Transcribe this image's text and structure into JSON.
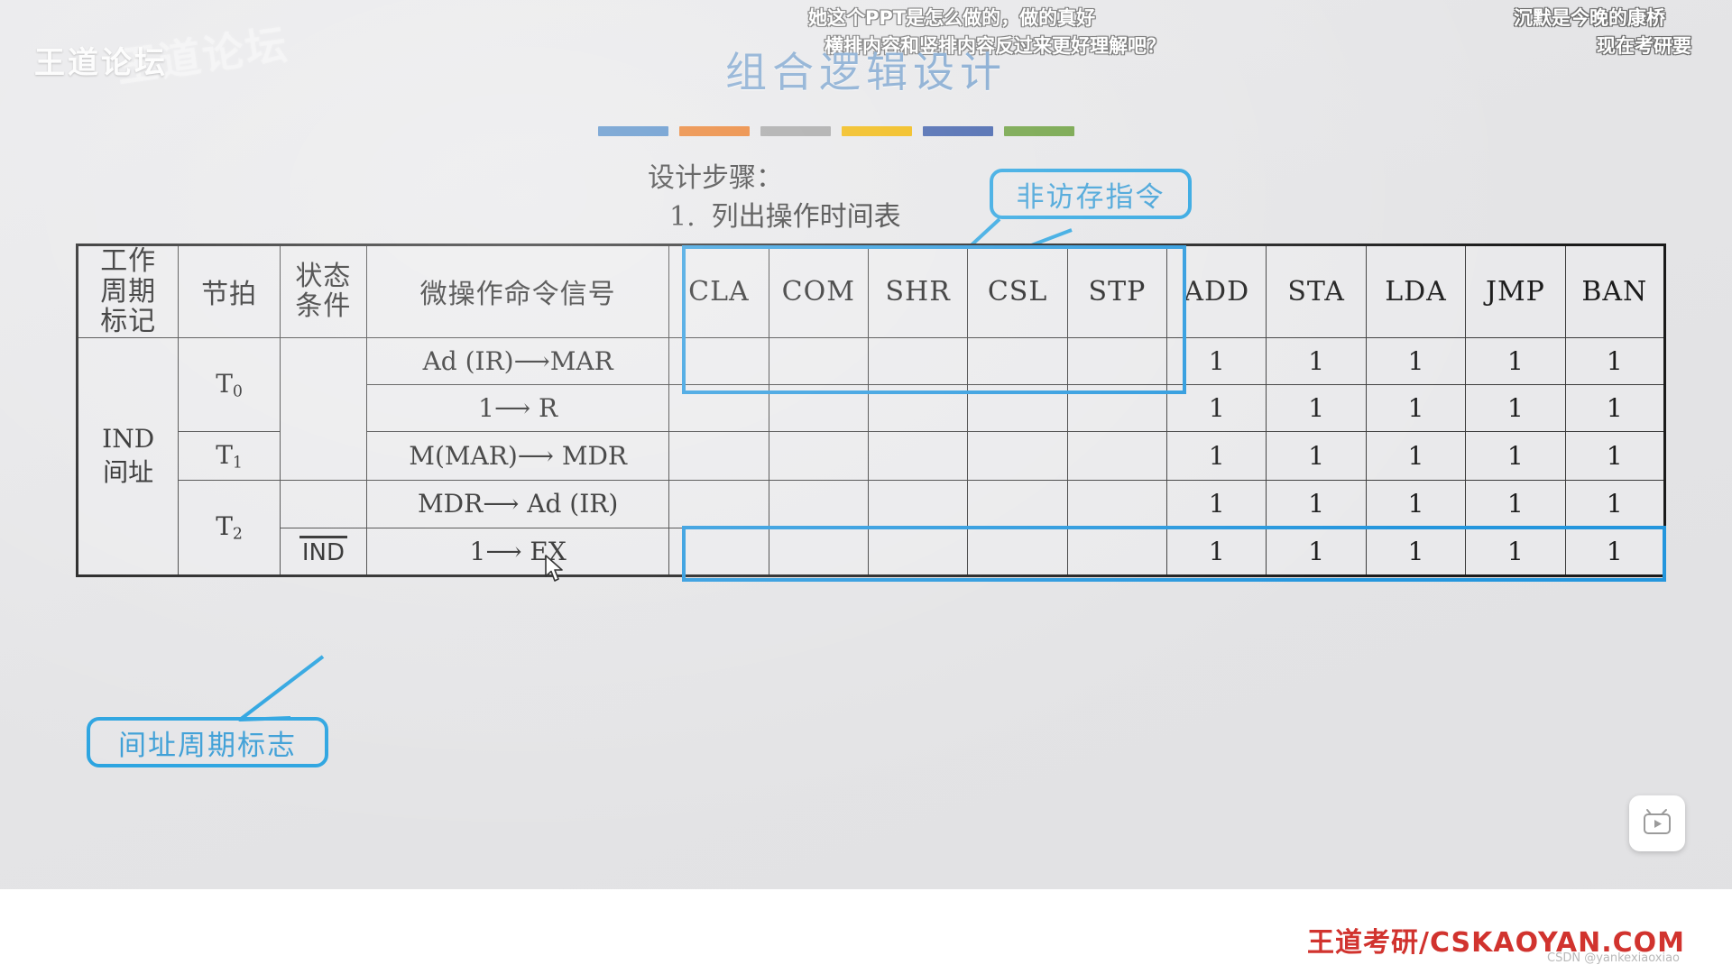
{
  "watermarks": {
    "forum": "王道论坛",
    "forum_ghost": "王道论坛",
    "bottom_brand": "王道考研/CSKAOYAN.COM",
    "csdn_credit": "CSDN @yankexiaoxiao"
  },
  "danmaku": [
    {
      "id": "dm-1",
      "text": "她这个PPT是怎么做的，做的真好"
    },
    {
      "id": "dm-2",
      "text": "横排内容和竖排内容反过来更好理解吧？"
    },
    {
      "id": "dm-3",
      "text": "沉默是今晚的康桥"
    },
    {
      "id": "dm-4",
      "text": "现在考研要"
    }
  ],
  "slide": {
    "title": "组合逻辑设计",
    "title_color": "#7ba3cd",
    "color_bars": [
      "#4a86c5",
      "#e8761e",
      "#a0a0a0",
      "#f0b400",
      "#3a5ba8",
      "#6a9e3c"
    ],
    "steps_heading": "设计步骤：",
    "step_number": "1.",
    "step_text": "列出操作时间表"
  },
  "callouts": {
    "top": {
      "label": "非访存指令",
      "color": "#29a3e0"
    },
    "bottom": {
      "label": "间址周期标志",
      "color": "#29a3e0"
    }
  },
  "highlight_color": "#2496dd",
  "table": {
    "headers": {
      "cycle": "工作\n周期\n标记",
      "cycle_l1": "工作",
      "cycle_l2": "周期",
      "cycle_l3": "标记",
      "beat": "节拍",
      "cond_l1": "状态",
      "cond_l2": "条件",
      "micro": "微操作命令信号",
      "instructions": [
        "CLA",
        "COM",
        "SHR",
        "CSL",
        "STP",
        "ADD",
        "STA",
        "LDA",
        "JMP",
        "BAN"
      ]
    },
    "cycle_label_l1": "IND",
    "cycle_label_l2": "间址",
    "beats": {
      "t0": "T",
      "t0_sub": "0",
      "t1": "T",
      "t1_sub": "1",
      "t2": "T",
      "t2_sub": "2"
    },
    "state_condition_overline": "IND",
    "rows": [
      {
        "beat": "T0",
        "cond": "",
        "micro": "Ad (IR)⟶MAR",
        "values": [
          "",
          "",
          "",
          "",
          "",
          "1",
          "1",
          "1",
          "1",
          "1"
        ]
      },
      {
        "beat": "T0",
        "cond": "",
        "micro": "1⟶ R",
        "values": [
          "",
          "",
          "",
          "",
          "",
          "1",
          "1",
          "1",
          "1",
          "1"
        ]
      },
      {
        "beat": "T1",
        "cond": "",
        "micro": "M(MAR)⟶ MDR",
        "values": [
          "",
          "",
          "",
          "",
          "",
          "1",
          "1",
          "1",
          "1",
          "1"
        ]
      },
      {
        "beat": "T2",
        "cond": "",
        "micro": "MDR⟶ Ad (IR)",
        "values": [
          "",
          "",
          "",
          "",
          "",
          "1",
          "1",
          "1",
          "1",
          "1"
        ]
      },
      {
        "beat": "T2",
        "cond": "IND",
        "micro": "1⟶ EX",
        "values": [
          "",
          "",
          "",
          "",
          "",
          "1",
          "1",
          "1",
          "1",
          "1"
        ]
      }
    ]
  }
}
